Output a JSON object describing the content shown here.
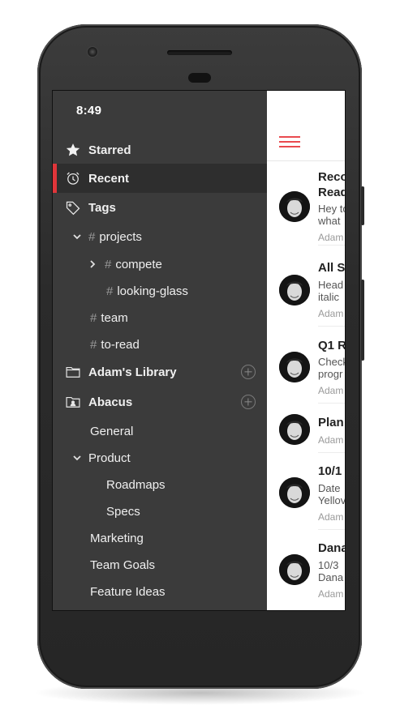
{
  "status_bar": {
    "time": "8:49"
  },
  "sidebar": {
    "items": [
      {
        "label": "Starred",
        "icon": "star-icon"
      },
      {
        "label": "Recent",
        "icon": "alarm-clock-icon",
        "active": true
      },
      {
        "label": "Tags",
        "icon": "tag-icon"
      },
      {
        "label": "projects",
        "hash": "#"
      },
      {
        "label": "compete",
        "hash": "#"
      },
      {
        "label": "looking-glass",
        "hash": "#"
      },
      {
        "label": "team",
        "hash": "#"
      },
      {
        "label": "to-read",
        "hash": "#"
      },
      {
        "label": "Adam's Library",
        "icon": "folder-icon"
      },
      {
        "label": "Abacus",
        "icon": "shared-folder-icon"
      },
      {
        "label": "General"
      },
      {
        "label": "Product"
      },
      {
        "label": "Roadmaps"
      },
      {
        "label": "Specs"
      },
      {
        "label": "Marketing"
      },
      {
        "label": "Team Goals"
      },
      {
        "label": "Feature Ideas"
      }
    ]
  },
  "notes": [
    {
      "title": "Reco",
      "title2": "Read",
      "preview": [
        "Hey to",
        "what"
      ],
      "author": "Adam"
    },
    {
      "title": "All S",
      "preview": [
        "Head",
        "italic"
      ],
      "author": "Adam"
    },
    {
      "title": "Q1 R",
      "preview": [
        "Check",
        "progr"
      ],
      "author": "Adam"
    },
    {
      "title": "Plan",
      "preview": [],
      "author": "Adam"
    },
    {
      "title": "10/1",
      "preview": [
        "Date",
        "Yellov"
      ],
      "author": "Adam"
    },
    {
      "title": "Dana",
      "preview": [
        "10/3",
        "Dana"
      ],
      "author": "Adam"
    }
  ],
  "colors": {
    "accent": "#e0353a",
    "sidebar_bg": "#3b3b3b",
    "active_bg": "#2e2e2e"
  }
}
